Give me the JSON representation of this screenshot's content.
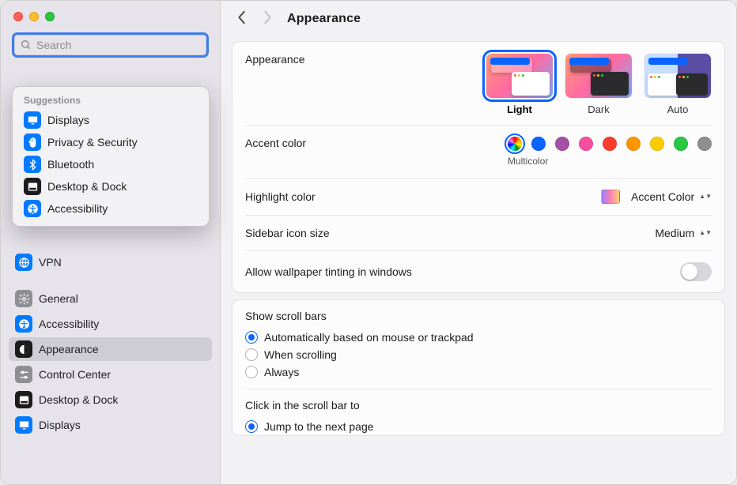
{
  "header": {
    "title": "Appearance"
  },
  "search": {
    "placeholder": "Search"
  },
  "suggestions": {
    "header": "Suggestions",
    "items": [
      {
        "label": "Displays",
        "icon": "display",
        "bg": "ic-blue"
      },
      {
        "label": "Privacy & Security",
        "icon": "hand",
        "bg": "ic-blue"
      },
      {
        "label": "Bluetooth",
        "icon": "bluetooth",
        "bg": "ic-blue"
      },
      {
        "label": "Desktop & Dock",
        "icon": "dock",
        "bg": "ic-black"
      },
      {
        "label": "Accessibility",
        "icon": "accessibility",
        "bg": "ic-blue"
      }
    ]
  },
  "sidebar": {
    "items": [
      {
        "label": "VPN",
        "icon": "globe",
        "bg": "ic-blue",
        "selected": false
      },
      {
        "label": "General",
        "icon": "gear",
        "bg": "ic-grey",
        "selected": false
      },
      {
        "label": "Accessibility",
        "icon": "accessibility",
        "bg": "ic-blue",
        "selected": false
      },
      {
        "label": "Appearance",
        "icon": "appearance",
        "bg": "ic-black",
        "selected": true
      },
      {
        "label": "Control Center",
        "icon": "sliders",
        "bg": "ic-grey",
        "selected": false
      },
      {
        "label": "Desktop & Dock",
        "icon": "dock",
        "bg": "ic-black",
        "selected": false
      },
      {
        "label": "Displays",
        "icon": "display",
        "bg": "ic-blue",
        "selected": false
      }
    ]
  },
  "appearance": {
    "label": "Appearance",
    "options": [
      {
        "label": "Light",
        "selected": true
      },
      {
        "label": "Dark",
        "selected": false
      },
      {
        "label": "Auto",
        "selected": false
      }
    ]
  },
  "accent": {
    "label": "Accent color",
    "sublabel": "Multicolor",
    "colors": [
      {
        "name": "multicolor",
        "css": "conic-gradient(red, orange, yellow, green, cyan, blue, violet, red)",
        "selected": true
      },
      {
        "name": "blue",
        "css": "#0a64ff"
      },
      {
        "name": "purple",
        "css": "#a550a7"
      },
      {
        "name": "pink",
        "css": "#f74f9e"
      },
      {
        "name": "red",
        "css": "#ff3b30"
      },
      {
        "name": "orange",
        "css": "#ff9500"
      },
      {
        "name": "yellow",
        "css": "#ffcc00"
      },
      {
        "name": "green",
        "css": "#28c840"
      },
      {
        "name": "graphite",
        "css": "#8e8e93"
      }
    ]
  },
  "highlight": {
    "label": "Highlight color",
    "value": "Accent Color"
  },
  "sidebar_icon": {
    "label": "Sidebar icon size",
    "value": "Medium"
  },
  "wallpaper_tint": {
    "label": "Allow wallpaper tinting in windows",
    "on": false
  },
  "scrollbars": {
    "title": "Show scroll bars",
    "options": [
      {
        "label": "Automatically based on mouse or trackpad",
        "checked": true
      },
      {
        "label": "When scrolling",
        "checked": false
      },
      {
        "label": "Always",
        "checked": false
      }
    ]
  },
  "click_scroll": {
    "title": "Click in the scroll bar to",
    "options": [
      {
        "label": "Jump to the next page",
        "checked": true
      }
    ]
  }
}
